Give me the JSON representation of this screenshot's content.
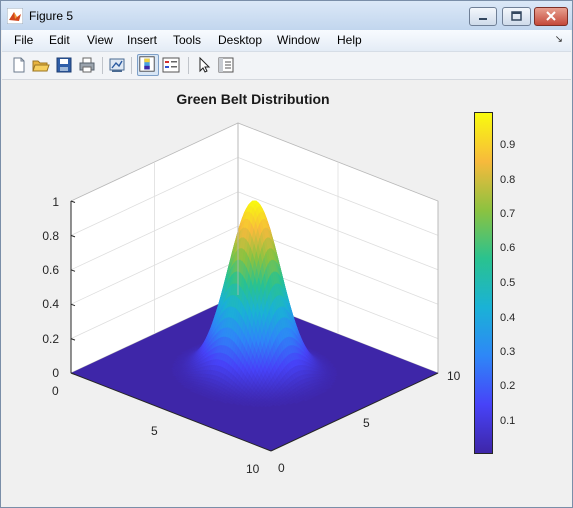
{
  "window": {
    "title": "Figure 5"
  },
  "menu": [
    "File",
    "Edit",
    "View",
    "Insert",
    "Tools",
    "Desktop",
    "Window",
    "Help"
  ],
  "toolbar": [
    "new-figure-icon",
    "open-folder-icon",
    "save-icon",
    "print-icon",
    "link-plot-icon",
    "insert-colorbar-icon",
    "insert-legend-icon",
    "pointer-icon",
    "property-inspector-icon"
  ],
  "figure": {
    "title": "Green Belt Distribution",
    "z_ticks": [
      "0",
      "0.2",
      "0.4",
      "0.6",
      "0.8",
      "1"
    ],
    "x_ticks": [
      "0",
      "5",
      "10"
    ],
    "y_ticks": [
      "0",
      "5",
      "10"
    ],
    "colorbar_ticks": [
      "0.1",
      "0.2",
      "0.3",
      "0.4",
      "0.5",
      "0.6",
      "0.7",
      "0.8",
      "0.9"
    ],
    "colormap": [
      "#3e26a8",
      "#4743f8",
      "#2e87f7",
      "#1ab2d6",
      "#2ac28f",
      "#8cc240",
      "#f7ba3c",
      "#f9fb0e"
    ]
  }
}
